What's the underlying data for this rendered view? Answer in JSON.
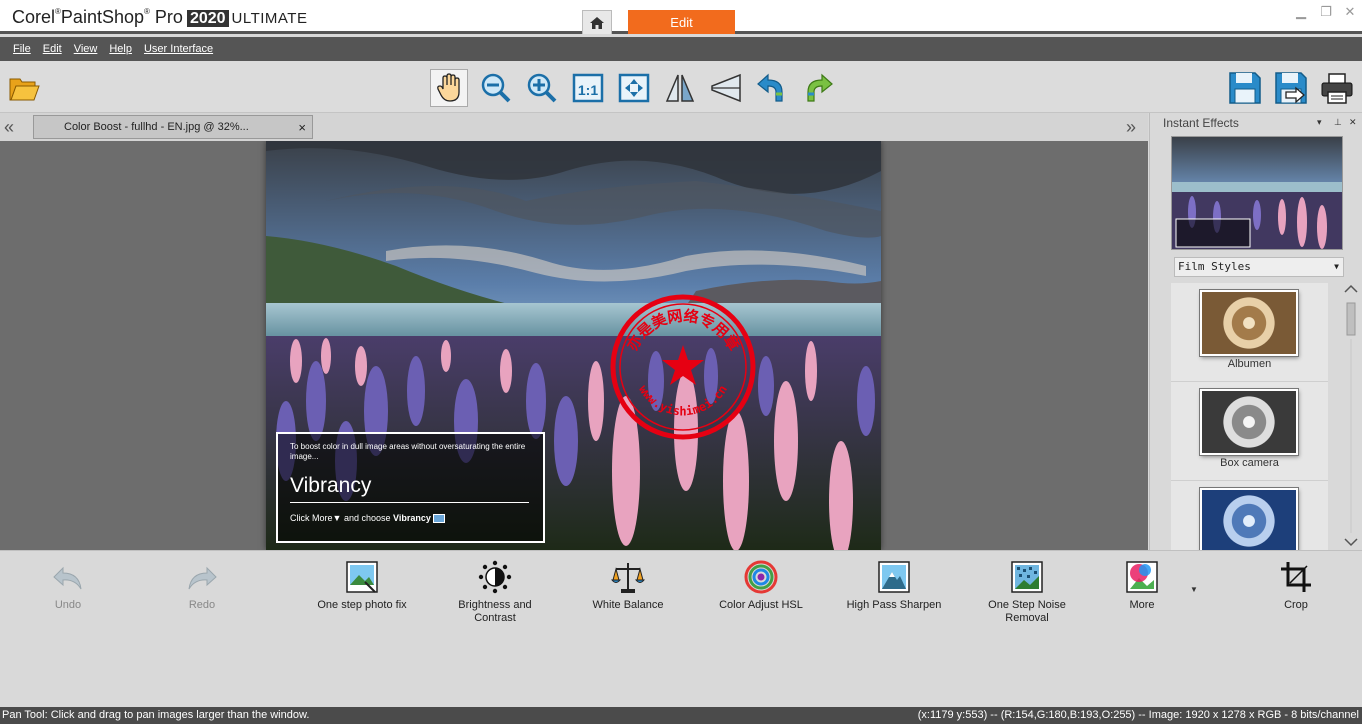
{
  "titlebar": {
    "brand": "Corel",
    "brand_mark": "®",
    "product": "PaintShop",
    "product_mark": "®",
    "product2": "Pro",
    "version": "2020",
    "edition": "ULTIMATE",
    "home_icon": "home-icon",
    "active_tab": "Edit"
  },
  "menu": {
    "file": "File",
    "edit": "Edit",
    "view": "View",
    "help": "Help",
    "ui": "User Interface"
  },
  "toolbar": {
    "icons": [
      "folder-open-icon",
      "pan-hand-icon",
      "zoom-out-icon",
      "zoom-in-icon",
      "actual-size-icon",
      "fit-window-icon",
      "flip-horizontal-icon",
      "flip-vertical-icon",
      "rotate-left-icon",
      "rotate-right-icon",
      "save-icon",
      "save-as-icon",
      "print-icon"
    ],
    "actual_size_label": "1:1"
  },
  "document": {
    "tab_title": "Color Boost - fullhd - EN.jpg @  32%...",
    "close": "×",
    "prev": "«",
    "next": "»"
  },
  "image_overlay": {
    "description": "To boost color in dull image areas without oversaturating the entire image...",
    "heading": "Vibrancy",
    "hint_prefix": "Click More",
    "hint_mid": " and choose ",
    "hint_bold": "Vibrancy",
    "stamp_text": "亦是美网络专用章",
    "stamp_url": "www.yishimei.cn"
  },
  "instant_effects": {
    "title": "Instant Effects",
    "dropdown": "Film Styles",
    "effects": [
      {
        "label": "Albumen"
      },
      {
        "label": "Box camera"
      },
      {
        "label": ""
      }
    ]
  },
  "bottombar": {
    "undo": "Undo",
    "redo": "Redo",
    "one_step_photo_fix": "One step photo fix",
    "brightness_1": "Brightness and",
    "brightness_2": "Contrast",
    "white_balance": "White Balance",
    "color_adjust_hsl": "Color Adjust HSL",
    "high_pass_sharpen": "High Pass Sharpen",
    "noise_1": "One Step Noise",
    "noise_2": "Removal",
    "more": "More",
    "crop": "Crop"
  },
  "status": {
    "left": "Pan Tool: Click and drag to pan images larger than the window.",
    "right": "(x:1179 y:553) -- (R:154,G:180,B:193,O:255) -- Image:  1920 x 1278 x RGB - 8 bits/channel"
  },
  "colors": {
    "accent": "#f26b1d",
    "menubar": "#555555",
    "statusbar": "#4b4b4b",
    "canvas": "#6d6d6d"
  }
}
